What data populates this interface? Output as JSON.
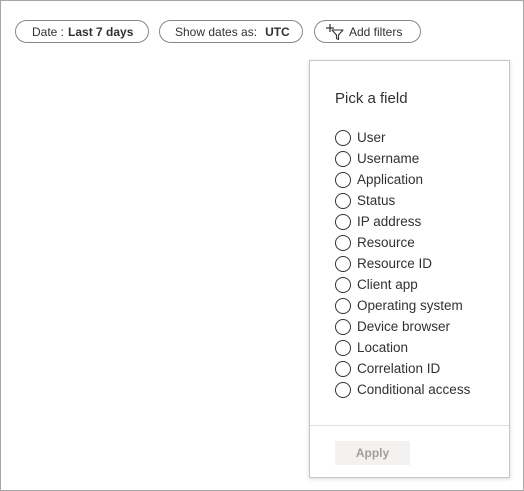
{
  "filters": {
    "date": {
      "label": "Date :",
      "value": "Last 7 days"
    },
    "timezone": {
      "label": "Show dates as:",
      "value": "UTC"
    },
    "add": {
      "label": "Add filters",
      "icon": "add-filter-icon"
    }
  },
  "field_picker": {
    "title": "Pick a field",
    "options": [
      "User",
      "Username",
      "Application",
      "Status",
      "IP address",
      "Resource",
      "Resource ID",
      "Client app",
      "Operating system",
      "Device browser",
      "Location",
      "Correlation ID",
      "Conditional access"
    ],
    "apply_label": "Apply",
    "apply_disabled": true
  },
  "colors": {
    "text": "#323130",
    "pill_border": "#8a8886",
    "disabled_button_bg": "#f3f2f1",
    "disabled_button_text": "#a19f9d"
  }
}
